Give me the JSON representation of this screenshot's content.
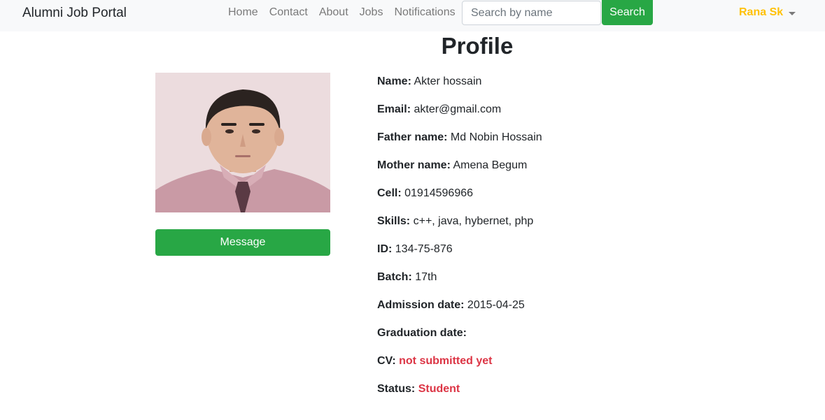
{
  "navbar": {
    "brand": "Alumni Job Portal",
    "links": [
      "Home",
      "Contact",
      "About",
      "Jobs",
      "Notifications"
    ],
    "search_placeholder": "Search by name",
    "search_button": "Search",
    "user_name": "Rana Sk"
  },
  "profile": {
    "title": "Profile",
    "message_button": "Message",
    "fields": [
      {
        "label": "Name:",
        "value": "Akter hossain"
      },
      {
        "label": "Email:",
        "value": "akter@gmail.com"
      },
      {
        "label": "Father name:",
        "value": "Md Nobin Hossain"
      },
      {
        "label": "Mother name:",
        "value": "Amena Begum"
      },
      {
        "label": "Cell:",
        "value": "01914596966"
      },
      {
        "label": "Skills:",
        "value": "c++, java, hybernet, php"
      },
      {
        "label": "ID:",
        "value": "134-75-876"
      },
      {
        "label": "Batch:",
        "value": "17th"
      },
      {
        "label": "Admission date:",
        "value": "2015-04-25"
      },
      {
        "label": "Graduation date:",
        "value": ""
      },
      {
        "label": "CV:",
        "value": "not submitted yet"
      },
      {
        "label": "Status:",
        "value": "Student"
      }
    ]
  },
  "colors": {
    "navbar_bg": "#f8f9fa",
    "success": "#28a745",
    "warning": "#ffc107",
    "danger": "#dc3545"
  }
}
